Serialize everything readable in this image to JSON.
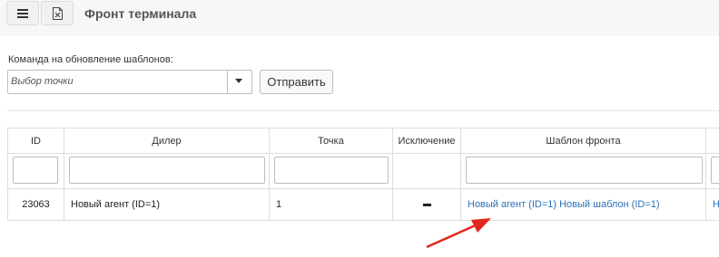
{
  "header": {
    "title": "Фронт терминала",
    "menu_icon": "hamburger-icon",
    "excel_icon": "excel-file-icon"
  },
  "command": {
    "label": "Команда на обновление шаблонов:",
    "select_placeholder": "Выбор точки",
    "send_label": "Отправить"
  },
  "table": {
    "columns": [
      "ID",
      "Дилер",
      "Точка",
      "Исключение",
      "Шаблон фронта"
    ],
    "rows": [
      {
        "id": "23063",
        "dealer": "Новый агент (ID=1)",
        "point": "1",
        "exclusion": "—",
        "template": "Новый агент (ID=1) Новый шаблон (ID=1)",
        "next_col_fragment": "Н"
      }
    ]
  },
  "colors": {
    "link": "#2a6fb5",
    "arrow": "#e3261c",
    "border": "#dddddd"
  }
}
